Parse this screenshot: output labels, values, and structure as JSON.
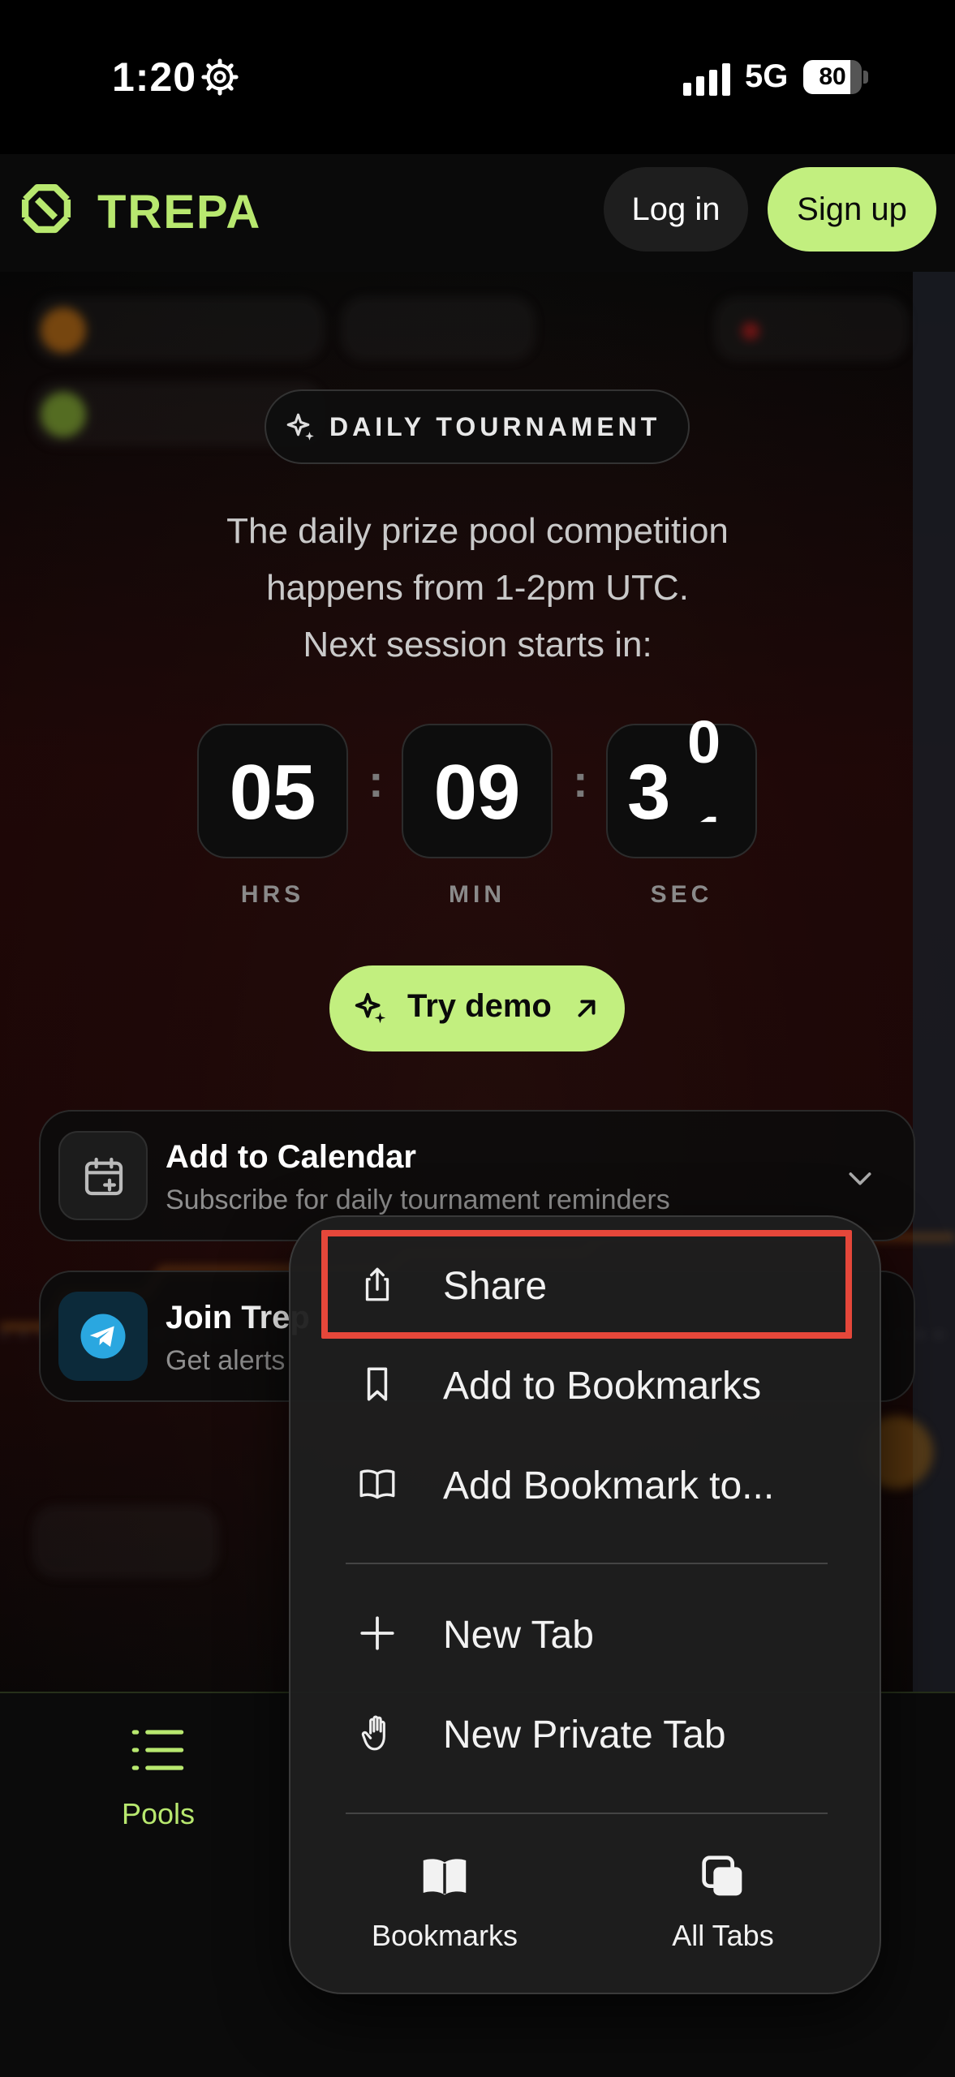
{
  "status_bar": {
    "time": "1:20",
    "network": "5G",
    "battery": 80
  },
  "header": {
    "brand": "TREPA",
    "login_label": "Log in",
    "signup_label": "Sign up"
  },
  "tournament": {
    "badge": "DAILY TOURNAMENT",
    "description": [
      "The daily prize pool competition",
      "happens from 1-2pm UTC.",
      "Next session starts in:"
    ],
    "timer": {
      "hours": "05",
      "minutes": "09",
      "seconds": "3",
      "hours_label": "HRS",
      "minutes_label": "MIN",
      "seconds_label": "SEC"
    },
    "demo_label": "Try demo"
  },
  "cards": [
    {
      "title": "Add to Calendar",
      "subtitle": "Subscribe for daily tournament reminders"
    },
    {
      "title": "Join Trep",
      "subtitle": "Get alerts"
    }
  ],
  "bottom_nav": {
    "pools_label": "Pools"
  },
  "menu": {
    "items": [
      "Share",
      "Add to Bookmarks",
      "Add Bookmark to...",
      "New Tab",
      "New Private Tab"
    ],
    "bottom": [
      "Bookmarks",
      "All Tabs"
    ]
  },
  "colors": {
    "accent": "#c2ef7f",
    "brand_text": "#b8e86f",
    "highlight": "#e5473a",
    "telegram": "#2aa7e0"
  }
}
